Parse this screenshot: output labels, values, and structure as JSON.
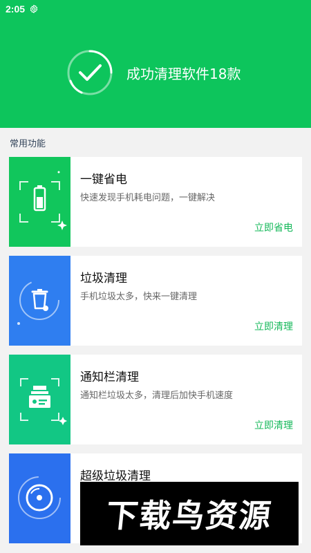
{
  "status_bar": {
    "time": "2:05",
    "icons": [
      "gear-icon"
    ]
  },
  "header": {
    "success_text": "成功清理软件18款",
    "icon": "checkmark-ring-icon",
    "color": "#0dc55c"
  },
  "section": {
    "title": "常用功能"
  },
  "cards": [
    {
      "title": "一键省电",
      "desc": "快速发现手机耗电问题，一键解决",
      "action": "立即省电",
      "icon": "battery-icon",
      "color": "#11c65c"
    },
    {
      "title": "垃圾清理",
      "desc": "手机垃圾太多，快来一键清理",
      "action": "立即清理",
      "icon": "trash-can-icon",
      "color": "#2f7ef0"
    },
    {
      "title": "通知栏清理",
      "desc": "通知栏垃圾太多，清理后加快手机速度",
      "action": "立即清理",
      "icon": "notification-stack-icon",
      "color": "#12c784"
    },
    {
      "title": "超级垃圾清理",
      "desc": "",
      "action": "",
      "icon": "disc-icon",
      "color": "#2b70ee"
    }
  ],
  "watermark": {
    "text": "下载鸟资源"
  },
  "accent_color": "#15b85a"
}
